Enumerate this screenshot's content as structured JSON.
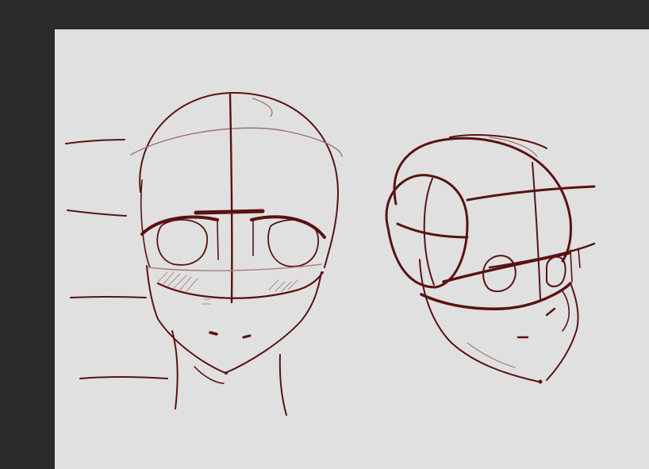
{
  "app": {
    "workspace_color": "#2b2b2b",
    "canvas_color": "#e0e0e0",
    "ink_color": "#5a1212"
  },
  "canvas": {
    "content": "sketch-two-head-construction-drawings"
  }
}
